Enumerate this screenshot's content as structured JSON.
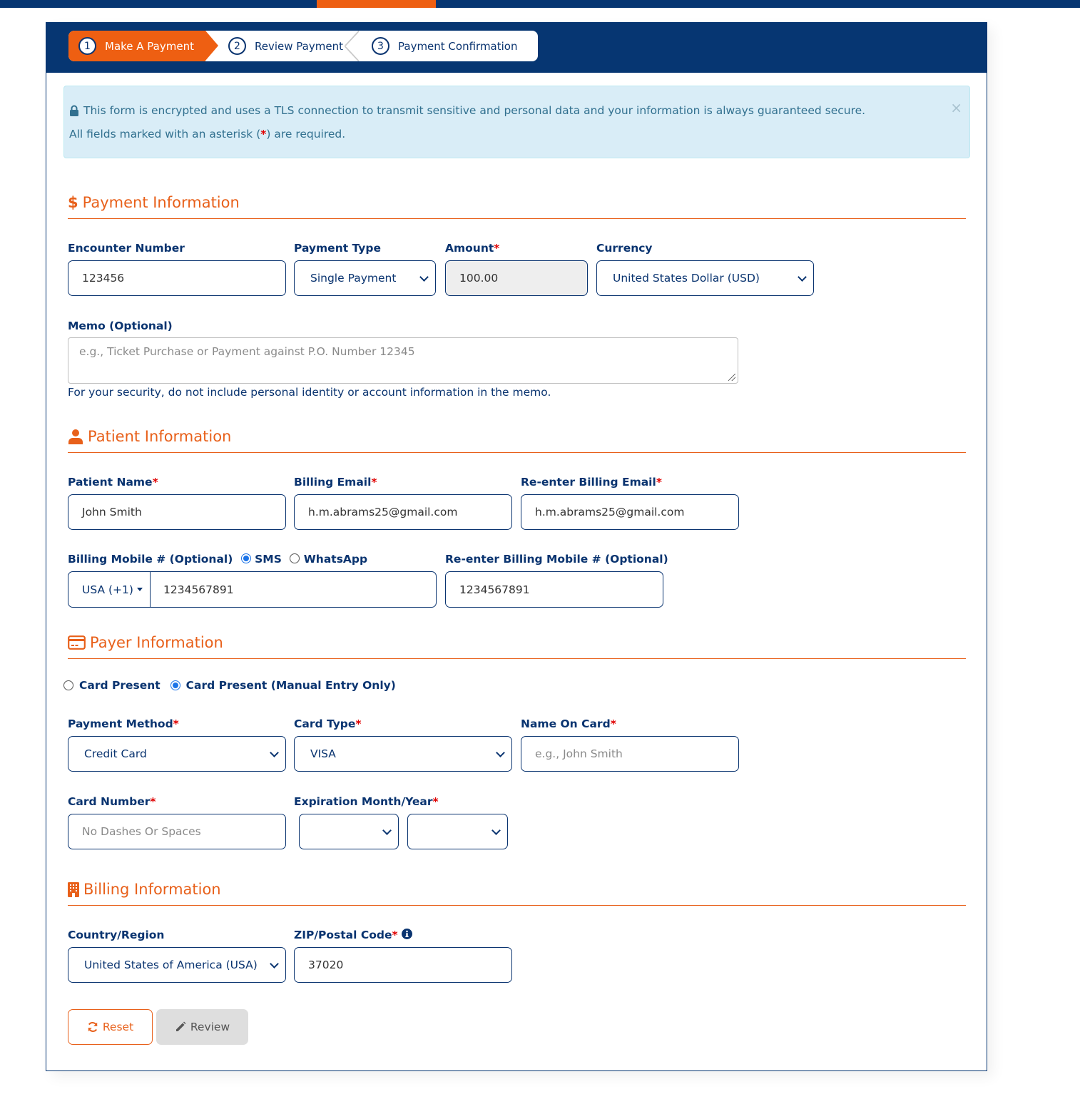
{
  "colors": {
    "navy": "#063672",
    "orange": "#ee5f12",
    "required": "#e00000",
    "alert_bg": "#d9edf7",
    "alert_text": "#31708f"
  },
  "steps": [
    {
      "num": "1",
      "label": "Make A Payment",
      "active": true
    },
    {
      "num": "2",
      "label": "Review Payment",
      "active": false
    },
    {
      "num": "3",
      "label": "Payment Confirmation",
      "active": false
    }
  ],
  "alert": {
    "icon": "lock-icon",
    "line1": "This form is encrypted and uses a TLS connection to transmit sensitive and personal data and your information is always guaranteed secure.",
    "line2_before": "All fields marked with an asterisk (",
    "line2_star": "*",
    "line2_after": ") are required.",
    "close": "×"
  },
  "payment": {
    "title": "Payment Information",
    "icon": "$",
    "encounter_label": "Encounter Number",
    "encounter_value": "123456",
    "type_label": "Payment Type",
    "type_value": "Single Payment",
    "amount_label": "Amount",
    "amount_value": "100.00",
    "currency_label": "Currency",
    "currency_value": "United States Dollar (USD)",
    "memo_label": "Memo (Optional)",
    "memo_placeholder": "e.g., Ticket Purchase or Payment against P.O. Number 12345",
    "memo_help": "For your security, do not include personal identity or account information in the memo."
  },
  "patient": {
    "title": "Patient Information",
    "name_label": "Patient Name",
    "name_value": "John Smith",
    "email_label": "Billing Email",
    "email_value": "h.m.abrams25@gmail.com",
    "reemail_label": "Re-enter Billing Email",
    "reemail_value": "h.m.abrams25@gmail.com",
    "mobile_label": "Billing Mobile # (Optional)",
    "sms_label": "SMS",
    "whatsapp_label": "WhatsApp",
    "sms_selected": true,
    "country_code": "USA (+1)",
    "mobile_value": "1234567891",
    "remobile_label": "Re-enter Billing Mobile # (Optional)",
    "remobile_value": "1234567891"
  },
  "payer": {
    "title": "Payer Information",
    "radio1": "Card Present",
    "radio2": "Card Present (Manual Entry Only)",
    "selected": "Card Present (Manual Entry Only)",
    "method_label": "Payment Method",
    "method_value": "Credit Card",
    "cardtype_label": "Card Type",
    "cardtype_value": "VISA",
    "nameoncard_label": "Name On Card",
    "nameoncard_placeholder": "e.g., John Smith",
    "cardnum_label": "Card Number",
    "cardnum_placeholder": "No Dashes Or Spaces",
    "exp_label": "Expiration Month/Year",
    "exp_month": "",
    "exp_year": ""
  },
  "billing": {
    "title": "Billing Information",
    "country_label": "Country/Region",
    "country_value": "United States of America (USA)",
    "zip_label": "ZIP/Postal Code",
    "zip_value": "37020"
  },
  "buttons": {
    "reset": "Reset",
    "review": "Review"
  },
  "required_star": "*"
}
